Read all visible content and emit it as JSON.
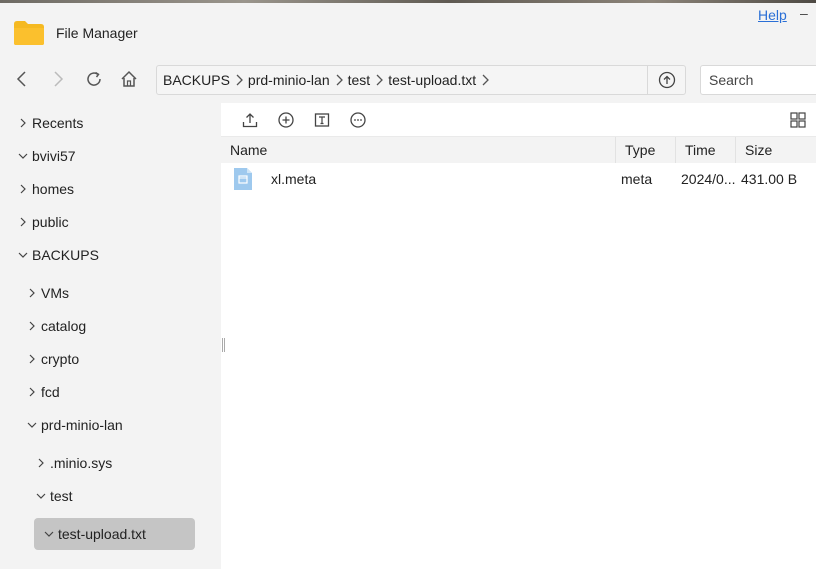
{
  "window": {
    "title": "File Manager"
  },
  "header": {
    "help_label": "Help",
    "minimize_label": "–"
  },
  "breadcrumb": {
    "items": [
      "BACKUPS",
      "prd-minio-lan",
      "test",
      "test-upload.txt"
    ]
  },
  "search": {
    "placeholder": "Search"
  },
  "sidebar": {
    "items": [
      {
        "label": "Recents",
        "state": "collapsed"
      },
      {
        "label": "bvivi57",
        "state": "expanded"
      },
      {
        "label": "homes",
        "state": "collapsed"
      },
      {
        "label": "public",
        "state": "collapsed"
      },
      {
        "label": "BACKUPS",
        "state": "expanded"
      },
      {
        "label": "VMs",
        "state": "collapsed"
      },
      {
        "label": "catalog",
        "state": "collapsed"
      },
      {
        "label": "crypto",
        "state": "collapsed"
      },
      {
        "label": "fcd",
        "state": "collapsed"
      },
      {
        "label": "prd-minio-lan",
        "state": "expanded"
      },
      {
        "label": ".minio.sys",
        "state": "collapsed"
      },
      {
        "label": "test",
        "state": "expanded"
      },
      {
        "label": "test-upload.txt",
        "state": "expanded",
        "selected": true
      }
    ]
  },
  "table": {
    "columns": [
      "Name",
      "Type",
      "Time",
      "Size"
    ],
    "rows": [
      {
        "name": "xl.meta",
        "type": "meta",
        "time": "2024/0...",
        "size": "431.00 B"
      }
    ]
  },
  "colors": {
    "accent": "#2a6fd6",
    "folder": "#f5b921",
    "selected": "#c5c5c5",
    "file_icon": "#9ec9ee"
  }
}
